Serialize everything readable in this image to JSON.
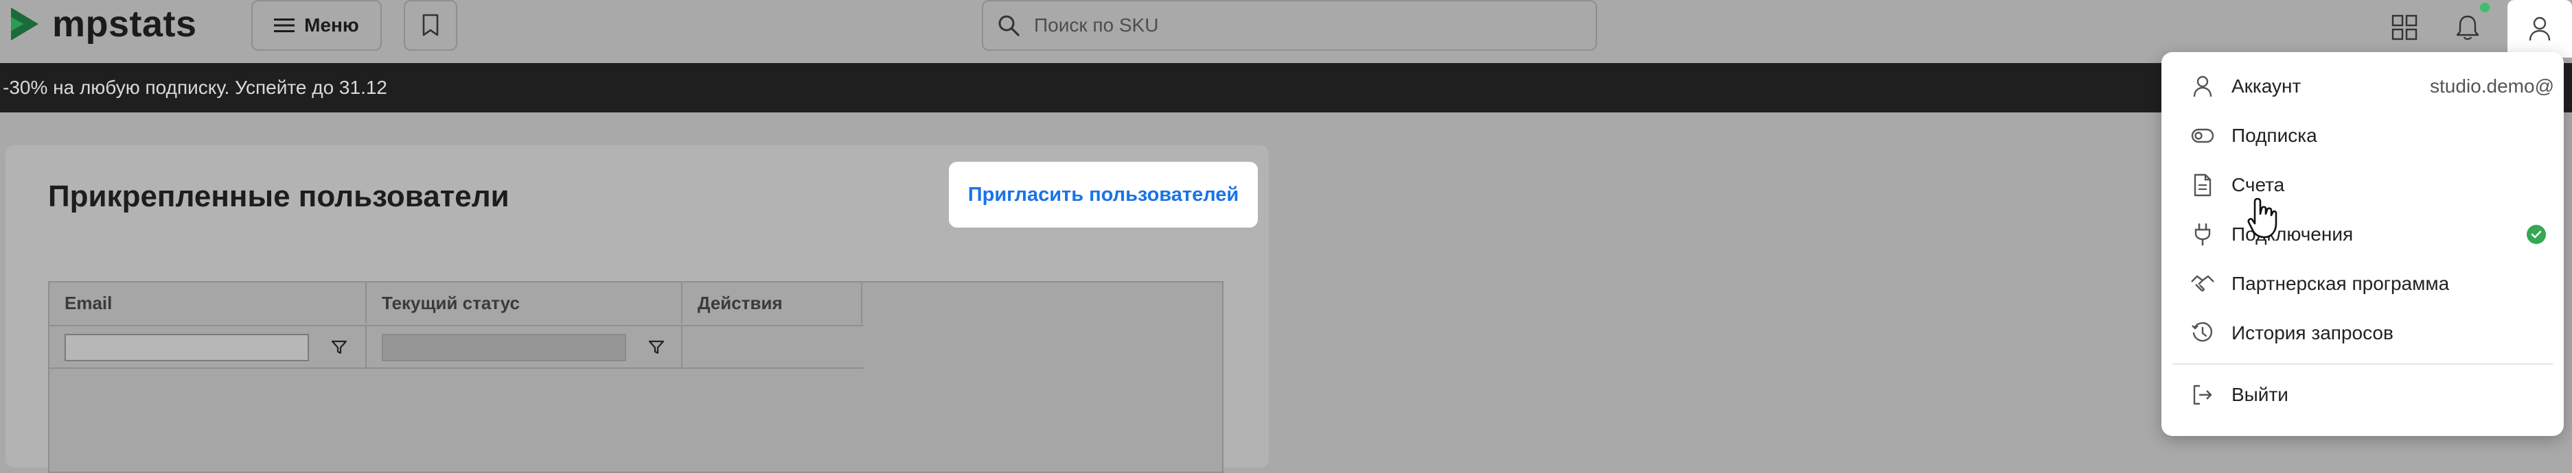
{
  "header": {
    "logo_text": "mpstats",
    "menu_label": "Меню",
    "search_placeholder": "Поиск по SKU",
    "icons": [
      "menu-icon",
      "bookmark-icon",
      "search-icon",
      "apps-grid-icon",
      "bell-icon",
      "user-icon"
    ],
    "notification_dot_color": "#3fbf6b"
  },
  "banner": {
    "text": "-30% на любую подписку. Успейте до 31.12"
  },
  "main": {
    "title": "Прикрепленные пользователи",
    "invite_button": "Пригласить пользователей",
    "table": {
      "columns": [
        "Email",
        "Текущий статус",
        "Действия"
      ]
    }
  },
  "user_menu": {
    "items": [
      {
        "label": "Аккаунт",
        "icon": "user-icon",
        "right": "studio.demo@"
      },
      {
        "label": "Подписка",
        "icon": "toggle-icon"
      },
      {
        "label": "Счета",
        "icon": "document-icon"
      },
      {
        "label": "Подключения",
        "icon": "plug-icon",
        "status": "connected",
        "status_color": "#34a853"
      },
      {
        "label": "Партнерская программа",
        "icon": "handshake-icon"
      },
      {
        "label": "История запросов",
        "icon": "history-icon"
      }
    ],
    "logout_label": "Выйти",
    "logout_icon": "logout-icon"
  },
  "colors": {
    "accent": "#1a73e8",
    "banner_bg": "#1f1f1f",
    "overlay": "#a9a9a9"
  }
}
